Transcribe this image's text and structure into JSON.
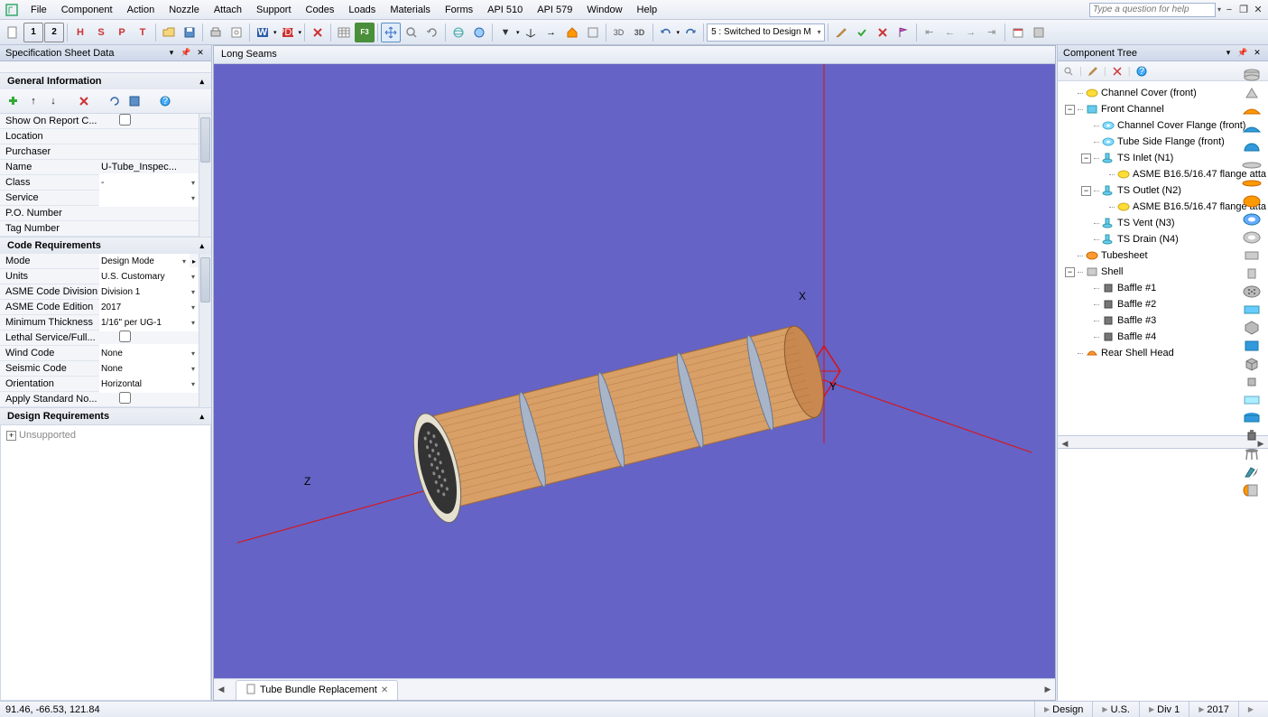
{
  "menu": [
    "File",
    "Component",
    "Action",
    "Nozzle",
    "Attach",
    "Support",
    "Codes",
    "Loads",
    "Materials",
    "Forms",
    "API 510",
    "API 579",
    "Window",
    "Help"
  ],
  "help_placeholder": "Type a question for help",
  "toolbar_dd": "5 : Switched to Design M",
  "left_panel_title": "Specification Sheet Data",
  "sections": {
    "general": {
      "title": "General Information",
      "rows": [
        {
          "label": "Show On Report C...",
          "checkbox": true
        },
        {
          "label": "Location",
          "value": ""
        },
        {
          "label": "Purchaser",
          "value": ""
        },
        {
          "label": "Name",
          "value": "U-Tube_Inspec..."
        },
        {
          "label": "Class",
          "value": "-",
          "dd": true
        },
        {
          "label": "Service",
          "value": "",
          "dd": true
        },
        {
          "label": "P.O. Number",
          "value": ""
        },
        {
          "label": "Tag Number",
          "value": ""
        }
      ]
    },
    "code": {
      "title": "Code Requirements",
      "rows": [
        {
          "label": "Mode",
          "value": "Design Mode",
          "dd": true,
          "extra": true
        },
        {
          "label": "Units",
          "value": "U.S. Customary",
          "dd": true
        },
        {
          "label": "ASME Code Division",
          "value": "Division 1",
          "dd": true
        },
        {
          "label": "ASME Code Edition",
          "value": "2017",
          "dd": true
        },
        {
          "label": "Minimum Thickness",
          "value": "1/16\" per UG-1",
          "dd": true
        },
        {
          "label": "Lethal Service/Full...",
          "checkbox": true
        },
        {
          "label": "Wind Code",
          "value": "None",
          "dd": true
        },
        {
          "label": "Seismic Code",
          "value": "None",
          "dd": true
        },
        {
          "label": "Orientation",
          "value": "Horizontal",
          "dd": true
        },
        {
          "label": "Apply Standard No...",
          "checkbox": true
        }
      ]
    },
    "design": {
      "title": "Design Requirements",
      "item": "Unsupported"
    }
  },
  "viewport_title": "Long Seams",
  "viewport_tab": "Tube Bundle Replacement",
  "axes": {
    "x": "X",
    "y": "Y",
    "z": "Z"
  },
  "right_panel_title": "Component Tree",
  "tree": [
    {
      "d": 0,
      "exp": "",
      "icon": "disc-yellow",
      "label": "Channel Cover (front)"
    },
    {
      "d": 0,
      "exp": "−",
      "icon": "cyl-cyan",
      "label": "Front Channel"
    },
    {
      "d": 1,
      "exp": "",
      "icon": "flange-cyan",
      "label": "Channel Cover Flange (front)"
    },
    {
      "d": 1,
      "exp": "",
      "icon": "flange-cyan",
      "label": "Tube Side Flange (front)"
    },
    {
      "d": 1,
      "exp": "−",
      "icon": "nozzle-cyan",
      "label": "TS Inlet (N1)"
    },
    {
      "d": 2,
      "exp": "",
      "icon": "disc-yellow",
      "label": "ASME B16.5/16.47 flange atta"
    },
    {
      "d": 1,
      "exp": "−",
      "icon": "nozzle-cyan",
      "label": "TS Outlet (N2)"
    },
    {
      "d": 2,
      "exp": "",
      "icon": "disc-yellow",
      "label": "ASME B16.5/16.47 flange atta"
    },
    {
      "d": 1,
      "exp": "",
      "icon": "nozzle-cyan",
      "label": "TS Vent (N3)"
    },
    {
      "d": 1,
      "exp": "",
      "icon": "nozzle-cyan",
      "label": "TS Drain (N4)"
    },
    {
      "d": 0,
      "exp": "",
      "icon": "disc-orange",
      "label": "Tubesheet"
    },
    {
      "d": 0,
      "exp": "−",
      "icon": "cyl-gray",
      "label": "Shell"
    },
    {
      "d": 1,
      "exp": "",
      "icon": "baffle",
      "label": "Baffle #1"
    },
    {
      "d": 1,
      "exp": "",
      "icon": "baffle",
      "label": "Baffle #2"
    },
    {
      "d": 1,
      "exp": "",
      "icon": "baffle",
      "label": "Baffle #3"
    },
    {
      "d": 1,
      "exp": "",
      "icon": "baffle",
      "label": "Baffle #4"
    },
    {
      "d": 0,
      "exp": "",
      "icon": "head-orange",
      "label": "Rear Shell Head"
    }
  ],
  "status": {
    "coords": "91.46, -66.53, 121.84",
    "items": [
      "Design",
      "U.S.",
      "Div 1",
      "2017"
    ]
  }
}
